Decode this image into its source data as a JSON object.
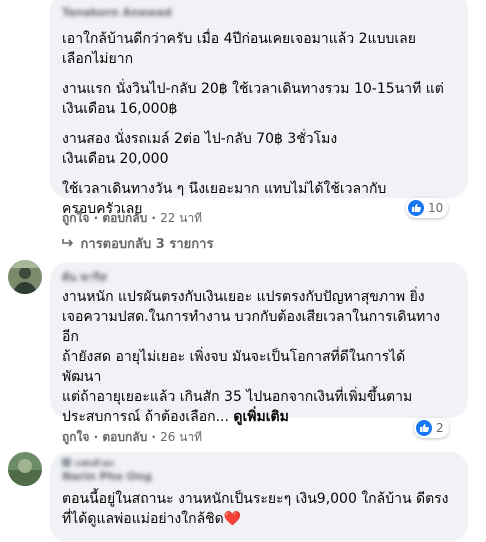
{
  "comment1": {
    "author": "Tanakorn Anawad",
    "paragraphs": [
      "เอาใกล้บ้านดีกว่าครับ เมื่อ 4ปีก่อนเคยเจอมาแล้ว 2แบบเลย\nเลือกไม่ยาก",
      "งานแรก นั่งวินไป-กลับ 20฿ ใช้เวลาเดินทางรวม 10-15นาที แต่\nเงินเดือน 16,000฿",
      "งานสอง นั่งรถเมล์ 2ต่อ ไป-กลับ 70฿ 3ชั่วโมง\nเงินเดือน 20,000",
      "ใช้เวลาเดินทางวัน ๆ นึงเยอะมาก แทบไม่ได้ใช้เวลากับ\nครอบครัวเลย"
    ],
    "like": "ถูกใจ",
    "reply": "ตอบกลับ",
    "time": "22 นาที",
    "reaction_count": "10",
    "replies_link": "การตอบกลับ 3 รายการ"
  },
  "comment2": {
    "author": "ต้น พาริส",
    "body": "งานหนัก แปรผันตรงกับเงินเยอะ แปรตรงกับปัญหาสุขภาพ ยิ่ง\nเจอความปสด.ในการทำงาน บวกกับต้องเสียเวลาในการเดินทาง\nอีก\nถ้ายังสด อายุไม่เยอะ เพิ่งจบ มันจะเป็นโอกาสที่ดีในการได้\nพัฒนา\nแต่ถ้าอายุเยอะแล้ว เกินสัก 35 ไปนอกจากเงินที่เพิ่มขึ้นตาม\nประสบการณ์ ถ้าต้องเลือก...",
    "see_more": "ดูเพิ่มเติม",
    "like": "ถูกใจ",
    "reply": "ตอบกลับ",
    "time": "26 นาที",
    "reaction_count": "2"
  },
  "comment3": {
    "badge": "แฟนตัวยง",
    "author": "Narin Pho Ong",
    "body": "ตอนนี้อยู่ในสถานะ งานหนักเป็นระยะๆ เงิน9,000 ใกล้บ้าน ดีตรง\nที่ได้ดูแลพ่อแม่อย่างใกล้ชิด",
    "emoji": "❤️"
  },
  "colors": {
    "bubble": "#f0f2f5",
    "meta": "#65676b",
    "like_blue": "#1877f2",
    "heart": "#e41e3f"
  }
}
